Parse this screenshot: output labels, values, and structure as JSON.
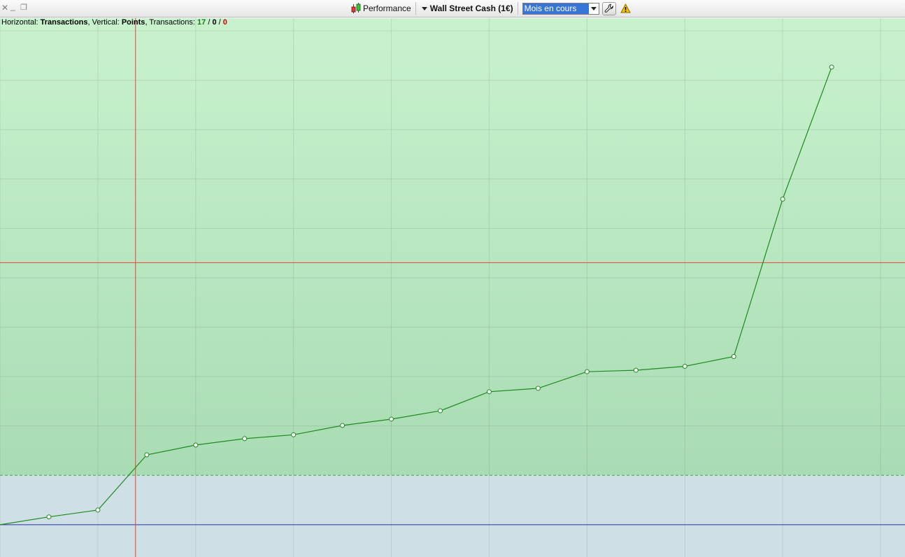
{
  "window": {
    "close_glyph": "✕",
    "minimize_glyph": "_",
    "restore_glyph": "❐"
  },
  "toolbar": {
    "performance_label": "Performance",
    "performance_icon": "candlestick-icon",
    "instrument_label": "Wall Street Cash (1€)",
    "period_selected": "Mois en cours",
    "settings_icon": "wrench-icon",
    "warning_icon": "warning-icon"
  },
  "info": {
    "horizontal_label": "Horizontal:",
    "horizontal_value": "Transactions",
    "vertical_label": ", Vertical:",
    "vertical_value": "Points",
    "transactions_label": ", Transactions:",
    "count_green": "17",
    "count_neutral": "0",
    "count_red": "0",
    "separator": " / "
  },
  "colors": {
    "positive_bg_top": "#c8f2cd",
    "positive_bg_bottom": "#a9dcb4",
    "negative_bg": "#cfdfe6",
    "line": "#1e8a1e",
    "crosshair": "#e8453c",
    "zero_line": "#2233aa"
  },
  "chart_data": {
    "type": "line",
    "x": [
      0,
      1,
      2,
      3,
      4,
      5,
      6,
      7,
      8,
      9,
      10,
      11,
      12,
      13,
      14,
      15,
      16,
      17
    ],
    "values": [
      0,
      16,
      30,
      143,
      163,
      176,
      184,
      203,
      216,
      233,
      272,
      279,
      313,
      316,
      324,
      344,
      666,
      936
    ],
    "xlim": [
      0,
      18.5
    ],
    "ylim": [
      -66,
      1036
    ],
    "y_grid_step": 101,
    "x_grid_step": 2,
    "grid": true,
    "crosshair": {
      "x": 2.77,
      "y": 536
    },
    "positive_threshold": 101,
    "zero_line": 0,
    "markers": "hollow-circle"
  }
}
